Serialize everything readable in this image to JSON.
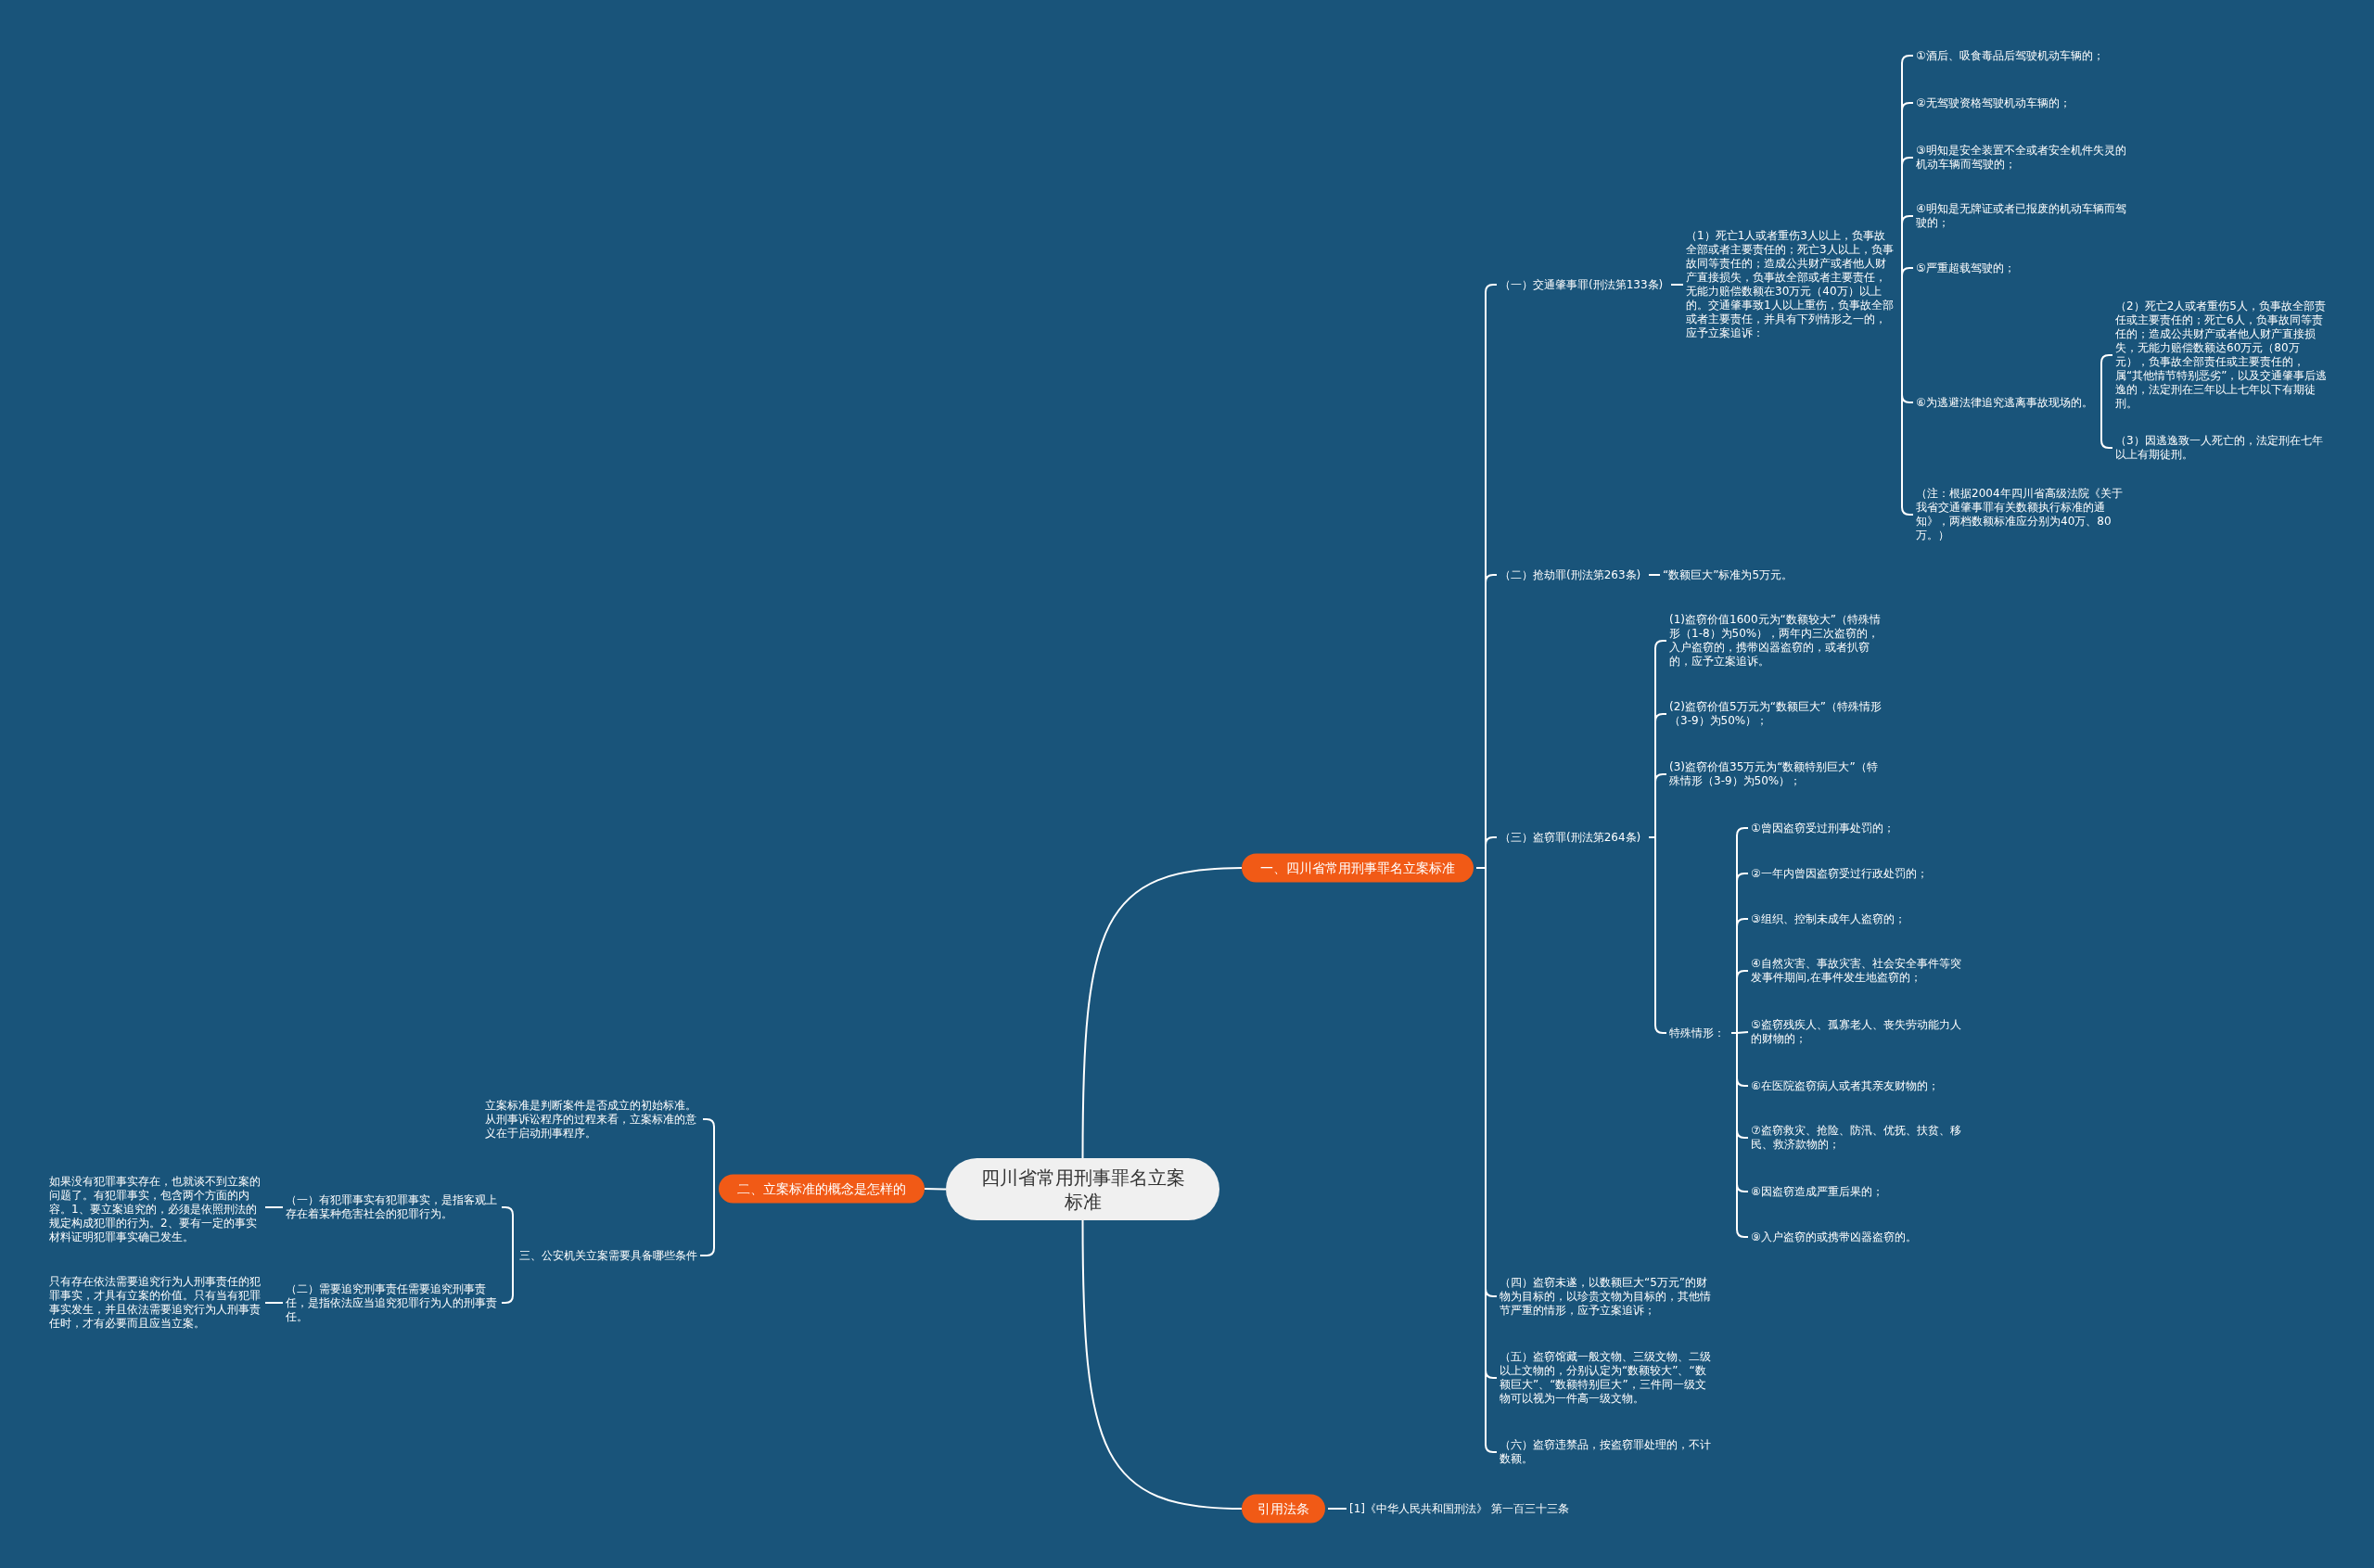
{
  "title": "四川省常用刑事罪名立案标准",
  "branches": [
    {
      "text": "一、四川省常用刑事罪名立案标准",
      "children": [
        {
          "text": "（一）交通肇事罪(刑法第133条)",
          "children": [
            {
              "text": "（1）死亡1人或者重伤3人以上，负事故全部或者主要责任的；死亡3人以上，负事故同等责任的；造成公共财产或者他人财产直接损失，负事故全部或者主要责任，无能力赔偿数额在30万元（40万）以上的。交通肇事致1人以上重伤，负事故全部或者主要责任，并具有下列情形之一的，应予立案追诉：",
              "children": [
                {
                  "text": "①酒后、吸食毒品后驾驶机动车辆的；"
                },
                {
                  "text": "②无驾驶资格驾驶机动车辆的；"
                },
                {
                  "text": "③明知是安全装置不全或者安全机件失灵的机动车辆而驾驶的；"
                },
                {
                  "text": "④明知是无牌证或者已报废的机动车辆而驾驶的；"
                },
                {
                  "text": "⑤严重超载驾驶的；"
                },
                {
                  "text": "⑥为逃避法律追究逃离事故现场的。",
                  "children": [
                    {
                      "text": "（2）死亡2人或者重伤5人，负事故全部责任或主要责任的；死亡6人，负事故同等责任的；造成公共财产或者他人财产直接损失，无能力赔偿数额达60万元（80万元），负事故全部责任或主要责任的，属“其他情节特别恶劣”，以及交通肇事后逃逸的，法定刑在三年以上七年以下有期徒刑。"
                    },
                    {
                      "text": "（3）因逃逸致一人死亡的，法定刑在七年以上有期徒刑。"
                    }
                  ]
                },
                {
                  "text": "（注：根据2004年四川省高级法院《关于我省交通肇事罪有关数额执行标准的通知》，两档数额标准应分别为40万、80万。）"
                }
              ]
            }
          ]
        },
        {
          "text": "（二）抢劫罪(刑法第263条)",
          "children": [
            {
              "text": "“数额巨大”标准为5万元。"
            }
          ]
        },
        {
          "text": "（三）盗窃罪(刑法第264条)",
          "children": [
            {
              "text": "(1)盗窃价值1600元为“数额较大”（特殊情形（1-8）为50%），两年内三次盗窃的，入户盗窃的，携带凶器盗窃的，或者扒窃的，应予立案追诉。"
            },
            {
              "text": "(2)盗窃价值5万元为“数额巨大”（特殊情形（3-9）为50%）；"
            },
            {
              "text": "(3)盗窃价值35万元为“数额特别巨大”（特殊情形（3-9）为50%）；"
            },
            {
              "text": "特殊情形：",
              "children": [
                {
                  "text": "①曾因盗窃受过刑事处罚的；"
                },
                {
                  "text": "②一年内曾因盗窃受过行政处罚的；"
                },
                {
                  "text": "③组织、控制未成年人盗窃的；"
                },
                {
                  "text": "④自然灾害、事故灾害、社会安全事件等突发事件期间,在事件发生地盗窃的；"
                },
                {
                  "text": "⑤盗窃残疾人、孤寡老人、丧失劳动能力人的财物的；"
                },
                {
                  "text": "⑥在医院盗窃病人或者其亲友财物的；"
                },
                {
                  "text": "⑦盗窃救灾、抢险、防汛、优抚、扶贫、移民、救济款物的；"
                },
                {
                  "text": "⑧因盗窃造成严重后果的；"
                },
                {
                  "text": "⑨入户盗窃的或携带凶器盗窃的。"
                }
              ]
            }
          ]
        },
        {
          "text": "（四）盗窃未遂，以数额巨大“5万元”的财物为目标的，以珍贵文物为目标的，其他情节严重的情形，应予立案追诉；"
        },
        {
          "text": "（五）盗窃馆藏一般文物、三级文物、二级以上文物的，分别认定为“数额较大”、“数额巨大”、“数额特别巨大”，三件同一级文物可以视为一件高一级文物。"
        },
        {
          "text": "（六）盗窃违禁品，按盗窃罪处理的，不计数额。"
        }
      ]
    },
    {
      "text": "二、立案标准的概念是怎样的",
      "children": [
        {
          "text": "立案标准是判断案件是否成立的初始标准。从刑事诉讼程序的过程来看，立案标准的意义在于启动刑事程序。"
        },
        {
          "text": "三、公安机关立案需要具备哪些条件",
          "children": [
            {
              "text": "（一）有犯罪事实有犯罪事实，是指客观上存在着某种危害社会的犯罪行为。",
              "children": [
                {
                  "text": "如果没有犯罪事实存在，也就谈不到立案的问题了。有犯罪事实，包含两个方面的内容。1、要立案追究的，必须是依照刑法的规定构成犯罪的行为。2、要有一定的事实材料证明犯罪事实确已发生。"
                }
              ]
            },
            {
              "text": "（二）需要追究刑事责任需要追究刑事责任，是指依法应当追究犯罪行为人的刑事责任。",
              "children": [
                {
                  "text": "只有存在依法需要追究行为人刑事责任的犯罪事实，才具有立案的价值。只有当有犯罪事实发生，并且依法需要追究行为人刑事责任时，才有必要而且应当立案。"
                }
              ]
            }
          ]
        }
      ]
    },
    {
      "text": "引用法条",
      "children": [
        {
          "text": "[1]《中华人民共和国刑法》 第一百三十三条"
        }
      ]
    }
  ]
}
